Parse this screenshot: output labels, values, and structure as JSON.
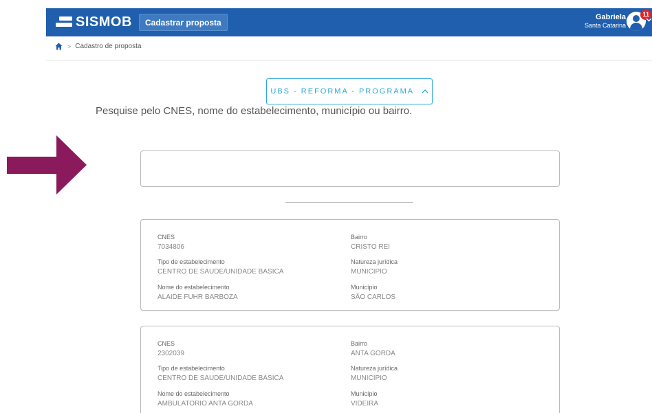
{
  "header": {
    "logo_text": "SISMOB",
    "nav_button": "Cadastrar proposta",
    "user_name": "Gabriela",
    "user_state": "Santa Catarina",
    "notification_count": "11",
    "brand_color": "#1f5fae"
  },
  "breadcrumb": {
    "icon": "home-icon",
    "current": "Cadastro de proposta"
  },
  "program_select": {
    "label": "UBS - REFORMA - PROGRAMA",
    "chevron": "^"
  },
  "search": {
    "hint": "Pesquise pelo CNES, nome do estabelecimento, município ou bairro.",
    "value": ""
  },
  "results": [
    {
      "cnes_label": "CNES",
      "cnes": "7034806",
      "bairro_label": "Bairro",
      "bairro": "CRISTO REI",
      "tipo_label": "Tipo de estabelecimento",
      "tipo": "CENTRO DE SAUDE/UNIDADE BASICA",
      "natureza_label": "Natureza jurídica",
      "natureza": "MUNICIPIO",
      "nome_label": "Nome do estabelecimento",
      "nome": "ALAIDE FUHR BARBOZA",
      "municipio_label": "Município",
      "municipio": "SÃO CARLOS"
    },
    {
      "cnes_label": "CNES",
      "cnes": "2302039",
      "bairro_label": "Bairro",
      "bairro": "ANTA GORDA",
      "tipo_label": "Tipo de estabelecimento",
      "tipo": "CENTRO DE SAUDE/UNIDADE BASICA",
      "natureza_label": "Natureza jurídica",
      "natureza": "MUNICIPIO",
      "nome_label": "Nome do estabelecimento",
      "nome": "AMBULATORIO ANTA GORDA",
      "municipio_label": "Município",
      "municipio": "VIDEIRA"
    }
  ],
  "annotation": {
    "arrow_color": "#8b1a5c"
  }
}
